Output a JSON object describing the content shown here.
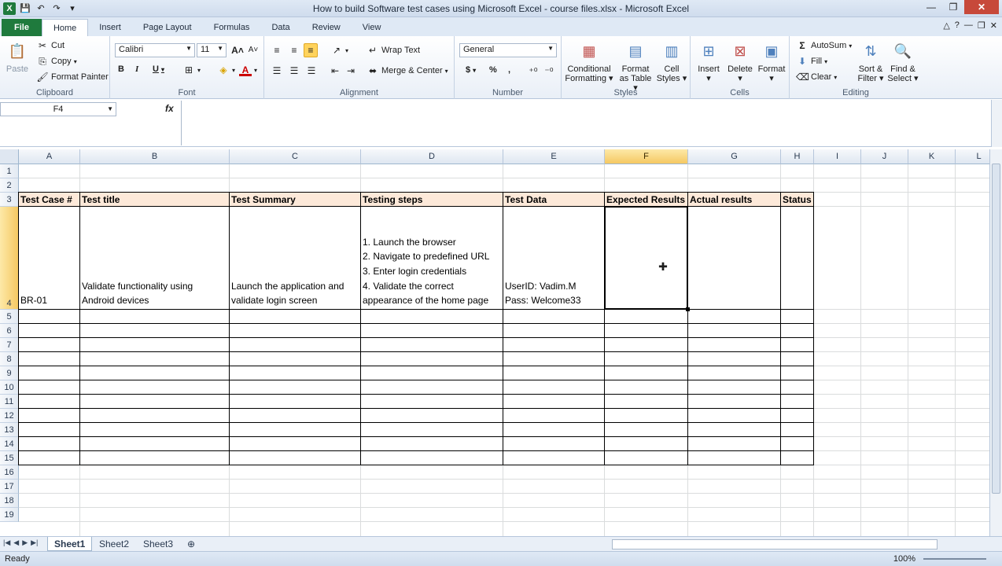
{
  "window": {
    "title": "How to build Software test cases using Microsoft Excel - course files.xlsx  -  Microsoft Excel"
  },
  "ribbon_tabs": [
    "File",
    "Home",
    "Insert",
    "Page Layout",
    "Formulas",
    "Data",
    "Review",
    "View"
  ],
  "ribbon": {
    "clipboard": {
      "paste": "Paste",
      "cut": "Cut",
      "copy": "Copy",
      "format_painter": "Format Painter",
      "label": "Clipboard"
    },
    "font": {
      "name": "Calibri",
      "size": "11",
      "label": "Font",
      "bold": "B",
      "italic": "I",
      "underline": "U"
    },
    "alignment": {
      "wrap_text": "Wrap Text",
      "merge_center": "Merge & Center",
      "label": "Alignment"
    },
    "number": {
      "format": "General",
      "label": "Number",
      "currency": "$",
      "percent": "%",
      "comma": ","
    },
    "styles": {
      "conditional_1": "Conditional",
      "conditional_2": "Formatting",
      "format_table_1": "Format",
      "format_table_2": "as Table",
      "cell_styles_1": "Cell",
      "cell_styles_2": "Styles",
      "label": "Styles"
    },
    "cells": {
      "insert": "Insert",
      "delete": "Delete",
      "format": "Format",
      "label": "Cells"
    },
    "editing": {
      "autosum": "AutoSum",
      "fill": "Fill",
      "clear": "Clear",
      "sort_1": "Sort &",
      "sort_2": "Filter",
      "find_1": "Find &",
      "find_2": "Select",
      "label": "Editing"
    }
  },
  "formula_bar": {
    "name_box": "F4",
    "fx": "fx",
    "content": ""
  },
  "columns": [
    "A",
    "B",
    "C",
    "D",
    "E",
    "F",
    "G",
    "H",
    "I",
    "J",
    "K",
    "L"
  ],
  "rows": [
    "1",
    "2",
    "3",
    "4",
    "5",
    "6",
    "7",
    "8",
    "9",
    "10",
    "11",
    "12",
    "13",
    "14",
    "15",
    "16",
    "17",
    "18",
    "19"
  ],
  "table": {
    "headers": [
      "Test Case #",
      "Test title",
      "Test Summary",
      "Testing steps",
      "Test Data",
      "Expected Results",
      "Actual results",
      "Status"
    ],
    "row4": {
      "a": "BR-01",
      "b": [
        "Validate functionality using",
        "Android devices"
      ],
      "c": [
        "Launch the application and",
        "validate login screen"
      ],
      "d": [
        "1. Launch the browser",
        "2. Navigate to predefined URL",
        "3. Enter login credentials",
        "4. Validate the correct",
        "appearance of the home page"
      ],
      "e": [
        "UserID: Vadim.M",
        "Pass: Welcome33"
      ]
    }
  },
  "sheets": [
    "Sheet1",
    "Sheet2",
    "Sheet3"
  ],
  "status": {
    "ready": "Ready",
    "zoom": "100%"
  },
  "colors": {
    "header_fill": "#fde9d9",
    "selection_header": "#f5c862",
    "file_tab": "#1f7a3d"
  }
}
